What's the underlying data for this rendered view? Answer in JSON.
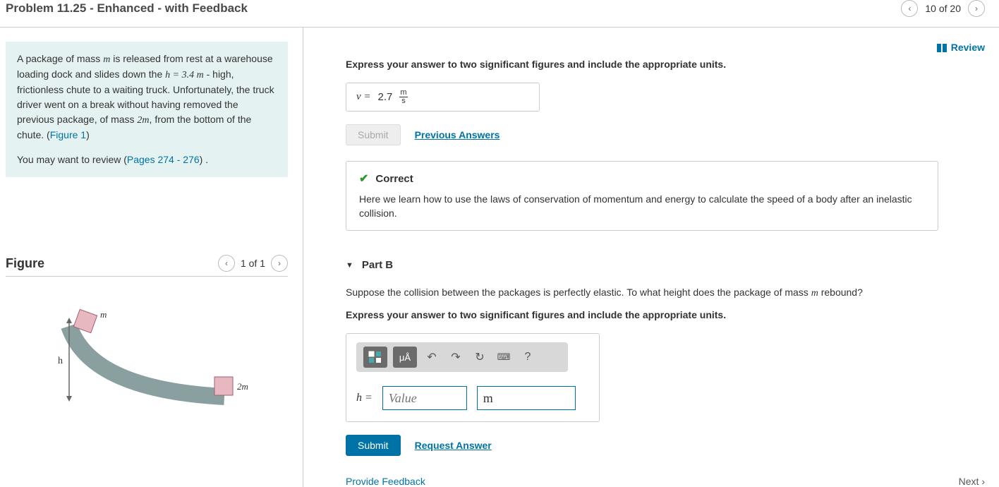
{
  "header": {
    "title": "Problem 11.25 - Enhanced - with Feedback",
    "pager": "10 of 20"
  },
  "review_label": "Review",
  "problem": {
    "text_prefix": "A package of mass ",
    "m": "m",
    "text_mid1": " is released from rest at a warehouse loading dock and slides down the ",
    "h_eq": "h = 3.4 m",
    "text_mid2": " - high, frictionless chute to a waiting truck. Unfortunately, the truck driver went on a break without having removed the previous package, of mass ",
    "twom": "2m",
    "text_mid3": ", from the bottom of the chute. (",
    "fig_link": "Figure 1",
    "text_end": ")",
    "review_prefix": "You may want to review (",
    "pages_link": "Pages 274 - 276",
    "review_suffix": ") ."
  },
  "figure": {
    "title": "Figure",
    "pager": "1 of 1",
    "label_m": "m",
    "label_h": "h",
    "label_2m": "2m"
  },
  "partA": {
    "instruction": "Express your answer to two significant figures and include the appropriate units.",
    "var_label": "v =",
    "value": "2.7",
    "unit_num": "m",
    "unit_den": "s",
    "submit": "Submit",
    "prev_answers": "Previous Answers",
    "fb_title": "Correct",
    "fb_body": "Here we learn how to use the laws of conservation of momentum and energy to calculate the speed of a body after an inelastic collision."
  },
  "partB": {
    "title": "Part B",
    "question_prefix": "Suppose the collision between the packages is perfectly elastic. To what height does the package of mass ",
    "m": "m",
    "question_suffix": " rebound?",
    "instruction": "Express your answer to two significant figures and include the appropriate units.",
    "tool_units": "μÅ",
    "tool_help": "?",
    "var_label": "h =",
    "value_placeholder": "Value",
    "unit_value": "m",
    "submit": "Submit",
    "request_answer": "Request Answer"
  },
  "footer": {
    "provide_feedback": "Provide Feedback",
    "next": "Next ›"
  }
}
